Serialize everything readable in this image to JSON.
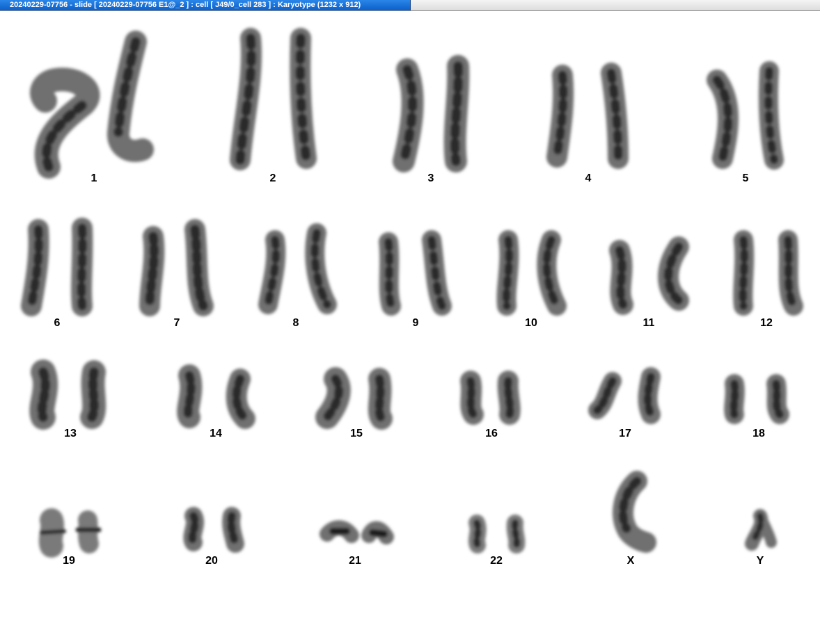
{
  "window": {
    "title": "20240229-07756 - slide [ 20240229-07756 E1@_2 ] : cell [ J49/0_cell 283 ] : Karyotype  (1232 x 912)"
  },
  "karyotype": {
    "labels": {
      "c1": "1",
      "c2": "2",
      "c3": "3",
      "c4": "4",
      "c5": "5",
      "c6": "6",
      "c7": "7",
      "c8": "8",
      "c9": "9",
      "c10": "10",
      "c11": "11",
      "c12": "12",
      "c13": "13",
      "c14": "14",
      "c15": "15",
      "c16": "16",
      "c17": "17",
      "c18": "18",
      "c19": "19",
      "c20": "20",
      "c21": "21",
      "c22": "22",
      "cX": "X",
      "cY": "Y"
    }
  }
}
